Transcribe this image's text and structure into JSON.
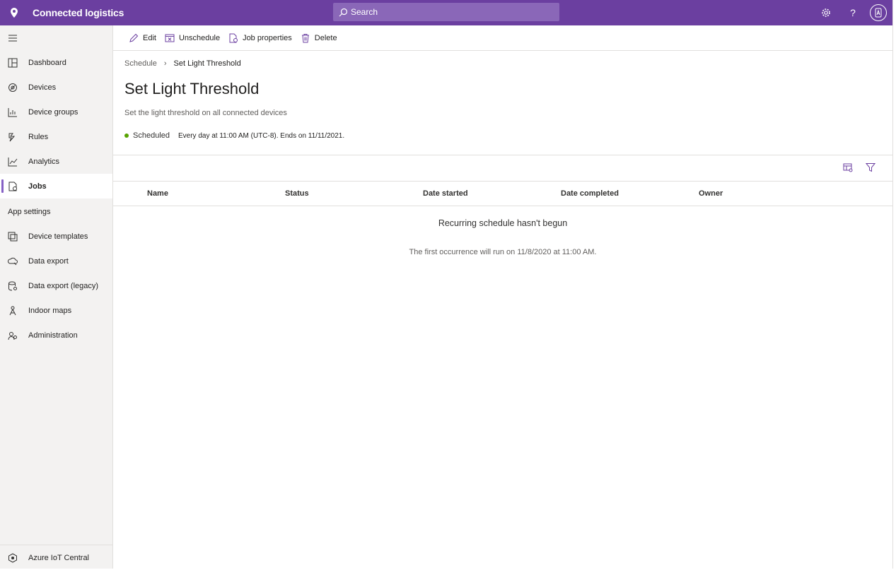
{
  "app": {
    "title": "Connected logistics",
    "search_placeholder": "Search"
  },
  "toolbar": {
    "edit": "Edit",
    "unschedule": "Unschedule",
    "job_properties": "Job properties",
    "delete": "Delete"
  },
  "sidebar": {
    "items": [
      {
        "label": "Dashboard",
        "icon": "dashboard-icon"
      },
      {
        "label": "Devices",
        "icon": "devices-icon"
      },
      {
        "label": "Device groups",
        "icon": "device-groups-icon"
      },
      {
        "label": "Rules",
        "icon": "rules-icon"
      },
      {
        "label": "Analytics",
        "icon": "analytics-icon"
      },
      {
        "label": "Jobs",
        "icon": "jobs-icon",
        "active": true
      }
    ],
    "section_label": "App settings",
    "settings_items": [
      {
        "label": "Device templates",
        "icon": "device-templates-icon"
      },
      {
        "label": "Data export",
        "icon": "data-export-icon"
      },
      {
        "label": "Data export (legacy)",
        "icon": "data-export-legacy-icon"
      },
      {
        "label": "Indoor maps",
        "icon": "indoor-maps-icon"
      },
      {
        "label": "Administration",
        "icon": "administration-icon"
      }
    ],
    "footer": "Azure IoT Central"
  },
  "breadcrumb": {
    "parent": "Schedule",
    "current": "Set Light Threshold"
  },
  "page": {
    "title": "Set Light Threshold",
    "description": "Set the light threshold on all connected devices",
    "status": "Scheduled",
    "schedule": "Every day at 11:00 AM (UTC-8). Ends on 11/11/2021.",
    "status_color": "#57a300"
  },
  "table": {
    "columns": [
      "Name",
      "Status",
      "Date started",
      "Date completed",
      "Owner"
    ],
    "empty_title": "Recurring schedule hasn't begun",
    "empty_subtitle": "The first occurrence will run on 11/8/2020 at 11:00 AM."
  },
  "colors": {
    "brand": "#6b3fa0",
    "accent": "#8661c5"
  }
}
